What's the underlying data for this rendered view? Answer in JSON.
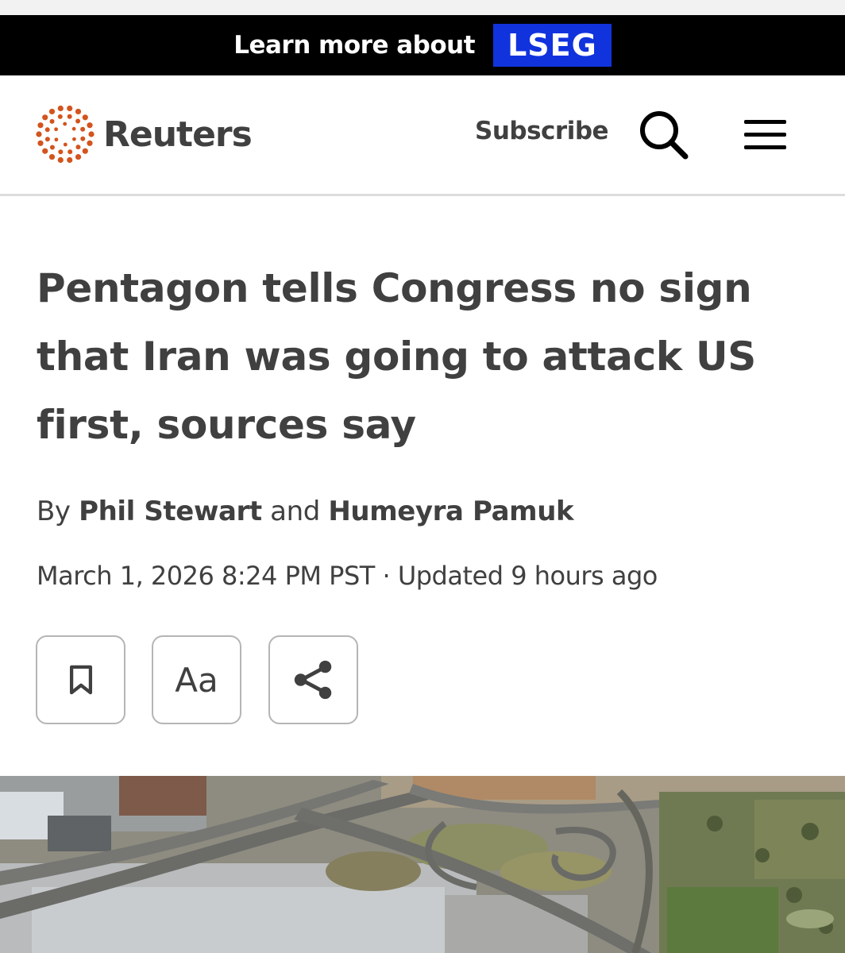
{
  "ad_banner": {
    "text": "Learn more about",
    "brand": "LSEG",
    "brand_color": "#1133dd"
  },
  "header": {
    "logo_text": "Reuters",
    "logo_icon": "reuters-dots-logo",
    "logo_color": "#d3541e",
    "subscribe_label": "Subscribe",
    "search_icon": "search-icon",
    "menu_icon": "hamburger-menu-icon"
  },
  "article": {
    "headline": "Pentagon tells Congress no sign that Iran was going to attack US first, sources say",
    "byline": {
      "prefix": "By",
      "author1": "Phil Stewart",
      "conjunction": "and",
      "author2": "Humeyra Pamuk"
    },
    "date": "March 1, 2026 8:24 PM PST",
    "separator": "·",
    "updated": "Updated 9 hours ago",
    "tools": [
      {
        "icon": "bookmark-icon"
      },
      {
        "icon": "text-size-icon",
        "label": "Aa"
      },
      {
        "icon": "share-icon"
      }
    ],
    "hero_image": "aerial-highway-interchange-photo"
  }
}
